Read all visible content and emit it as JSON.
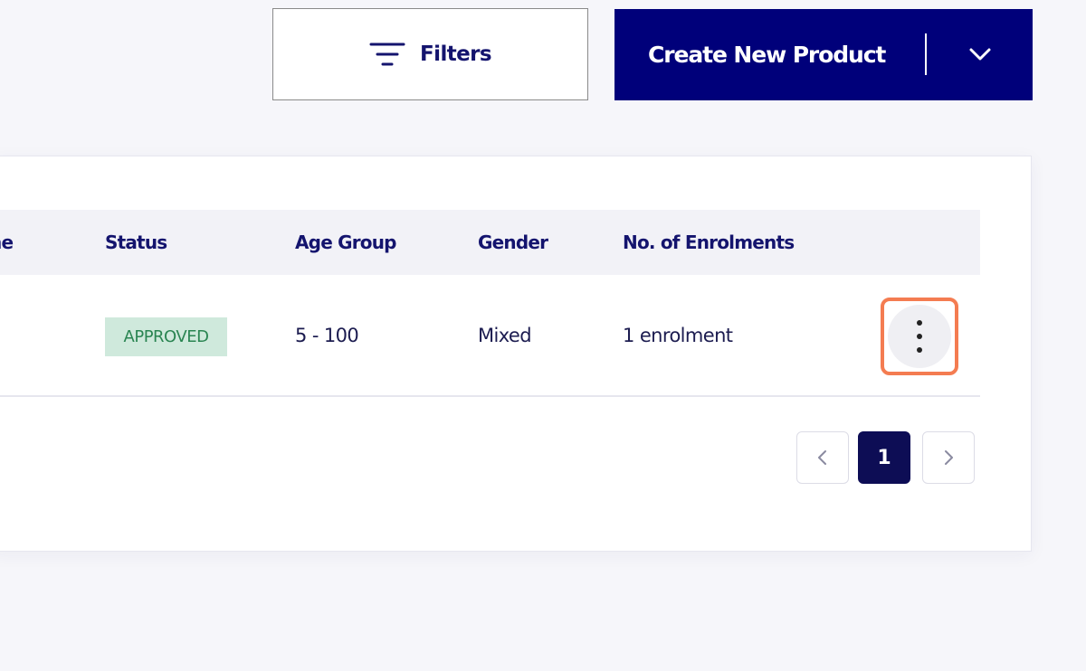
{
  "toolbar": {
    "filters_label": "Filters",
    "create_label": "Create New Product"
  },
  "table": {
    "columns": [
      "ne",
      "Status",
      "Age Group",
      "Gender",
      "No. of Enrolments"
    ],
    "rows": [
      {
        "status": "APPROVED",
        "age_group": "5 - 100",
        "gender": "Mixed",
        "enrolments": "1 enrolment"
      }
    ]
  },
  "pagination": {
    "current_page": "1"
  },
  "colors": {
    "primary": "#00007a",
    "badge_bg": "#cfe9dc",
    "badge_text": "#2a8552",
    "highlight": "#f47c51"
  },
  "icons": {
    "filters": "filter-lines-icon",
    "dropdown": "chevron-down-icon",
    "more": "more-vertical-icon",
    "prev": "chevron-left-icon",
    "next": "chevron-right-icon"
  }
}
